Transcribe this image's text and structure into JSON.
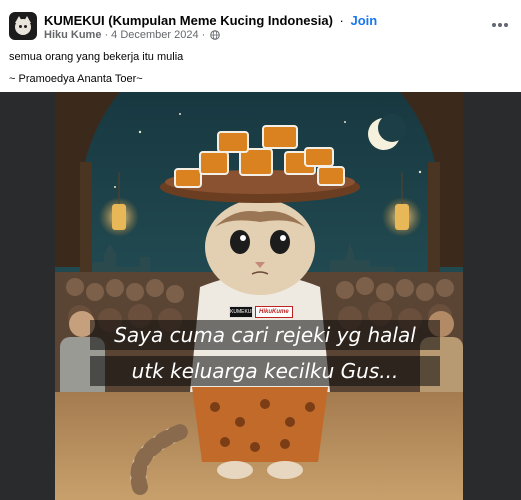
{
  "post": {
    "group_name": "KUMEKUI (Kumpulan Meme Kucing Indonesia)",
    "separator": "·",
    "join_label": "Join",
    "author": "Hiku Kume",
    "date": "4 December 2024",
    "caption_line1": "semua orang yang bekerja itu mulia",
    "caption_line2": "~ Pramoedya Ananta Toer~"
  },
  "image": {
    "overlay_line1": "Saya cuma cari rejeki yg halal",
    "overlay_line2": "utk keluarga kecilku Gus...",
    "watermark_left": "KUMEKUI",
    "watermark_right": "HikuKume"
  },
  "colors": {
    "link": "#1877f2",
    "meta": "#65676b",
    "sky": "#1f4a55",
    "floor": "#b48a5a"
  },
  "icons": {
    "globe": "globe-icon",
    "more": "more-icon"
  }
}
